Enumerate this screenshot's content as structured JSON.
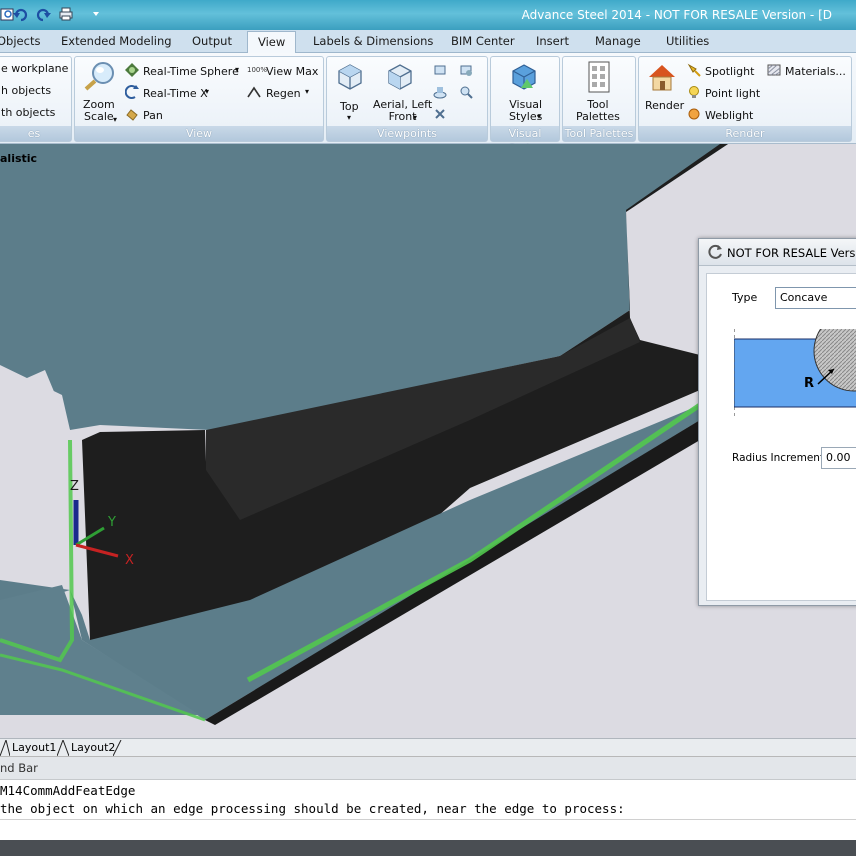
{
  "app": {
    "title": "Advance Steel 2014 - NOT FOR RESALE Version - [D"
  },
  "tabs": [
    "Objects",
    "Extended Modeling",
    "Output",
    "View",
    "Labels & Dimensions",
    "BIM Center",
    "Insert",
    "Manage",
    "Utilities"
  ],
  "active_tab": "View",
  "ribbon": {
    "ucs_panel": {
      "items": [
        "e workplane",
        "h objects",
        "th objects"
      ],
      "title": "es"
    },
    "view_panel": {
      "zoom_scale": "Zoom\nScale",
      "realtime_sphere": "Real-Time Sphere",
      "realtime_x": "Real-Time X",
      "pan": "Pan",
      "view_max": "View Max",
      "regen": "Regen",
      "title": "View"
    },
    "viewpoints_panel": {
      "top": "Top",
      "aerial": "Aerial, Left\nFront",
      "title": "Viewpoints"
    },
    "visual_styles_panel": {
      "label": "Visual\nStyles",
      "title": "Visual Styles"
    },
    "tool_palettes_panel": {
      "label": "Tool\nPalettes",
      "title": "Tool Palettes"
    },
    "render_panel": {
      "render": "Render",
      "spotlight": "Spotlight",
      "point_light": "Point light",
      "weblight": "Weblight",
      "materials": "Materials...",
      "title": "Render"
    }
  },
  "viewport": {
    "visual_style_label": "alistic",
    "axis": {
      "x": "X",
      "y": "Y",
      "z": "Z"
    },
    "layout_tabs": [
      "Layout1",
      "Layout2"
    ]
  },
  "dialog": {
    "title": "NOT FOR RESALE Versio",
    "type_label": "Type",
    "type_value": "Concave",
    "radius_symbol": "R",
    "radius_increment_label": "Radius Increment",
    "radius_increment_value": "0.00"
  },
  "command_bar": {
    "header": "nd Bar",
    "line1": "M14CommAddFeatEdge",
    "line2": " the object on which an edge processing should be created, near the edge to process:"
  },
  "colors": {
    "accent": "#3fa9c9",
    "beam_top": "#5f7f8c",
    "beam_side": "#1e1e1e",
    "highlight": "#52c84e",
    "viewport_bg": "#dcdbe2"
  }
}
